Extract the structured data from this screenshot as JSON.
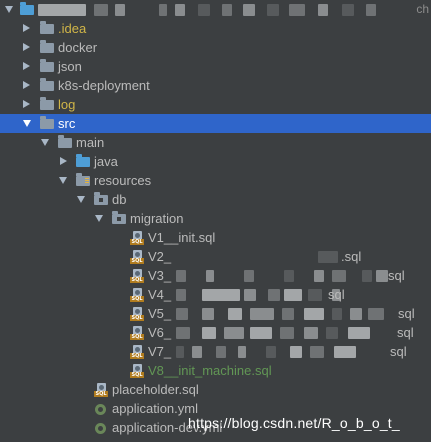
{
  "header": {
    "right_text": "ch"
  },
  "tree": {
    "idea": ".idea",
    "docker": "docker",
    "json": "json",
    "k8s": "k8s-deployment",
    "log": "log",
    "src": "src",
    "main": "main",
    "java": "java",
    "resources": "resources",
    "db": "db",
    "migration": "migration",
    "sql_tag": "SQL",
    "files": {
      "v1": "V1__init.sql",
      "v2_prefix": "V2_",
      "v2_suffix": ".sql",
      "v3_prefix": "V3_",
      "v3_suffix": "sql",
      "v4_prefix": "V4_",
      "v4_suffix": "sql",
      "v5_prefix": "V5_",
      "v5_suffix": "sql",
      "v6_prefix": "V6_",
      "v6_suffix": "sql",
      "v7_prefix": "V7_",
      "v7_suffix": "sql",
      "v8": "V8__init_machine.sql",
      "placeholder": "placeholder.sql",
      "application": "application.yml",
      "application_dev": "application-dev.yml"
    }
  },
  "watermark": "https://blog.csdn.net/R_o_b_o_t_"
}
